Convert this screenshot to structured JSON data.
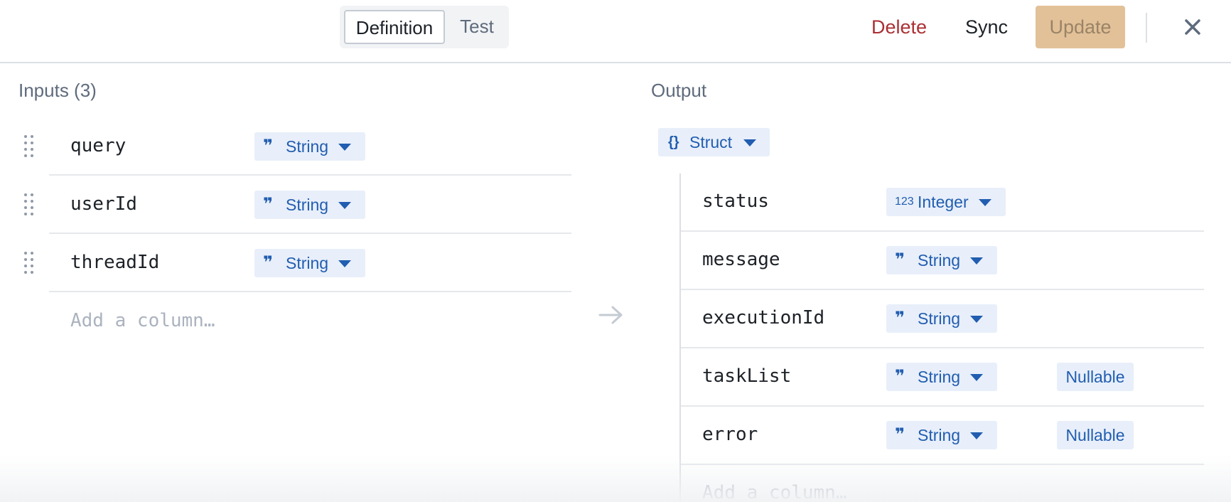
{
  "header": {
    "tabs": [
      {
        "label": "Definition",
        "active": true
      },
      {
        "label": "Test",
        "active": false
      }
    ],
    "delete_label": "Delete",
    "sync_label": "Sync",
    "update_label": "Update"
  },
  "inputs": {
    "title": "Inputs (3)",
    "rows": [
      {
        "name": "query",
        "type": "String"
      },
      {
        "name": "userId",
        "type": "String"
      },
      {
        "name": "threadId",
        "type": "String"
      }
    ],
    "add_placeholder": "Add a column…"
  },
  "output": {
    "title": "Output",
    "type": "Struct",
    "fields": [
      {
        "name": "status",
        "type": "Integer",
        "type_icon": "123",
        "nullable": ""
      },
      {
        "name": "message",
        "type": "String",
        "nullable": ""
      },
      {
        "name": "executionId",
        "type": "String",
        "nullable": ""
      },
      {
        "name": "taskList",
        "type": "String",
        "nullable": "Nullable"
      },
      {
        "name": "error",
        "type": "String",
        "nullable": "Nullable"
      }
    ],
    "add_placeholder": "Add a column…"
  },
  "colors": {
    "accent": "#215db0",
    "tag_bg": "#e8effa",
    "danger": "#ac2f33",
    "update_bg": "#e2c199"
  },
  "icons": {
    "close": "close-icon",
    "drag": "drag-handle-icon",
    "string": "quote-icon",
    "integer": "numeric-icon",
    "struct": "braces-icon",
    "arrow": "arrow-right-icon"
  }
}
